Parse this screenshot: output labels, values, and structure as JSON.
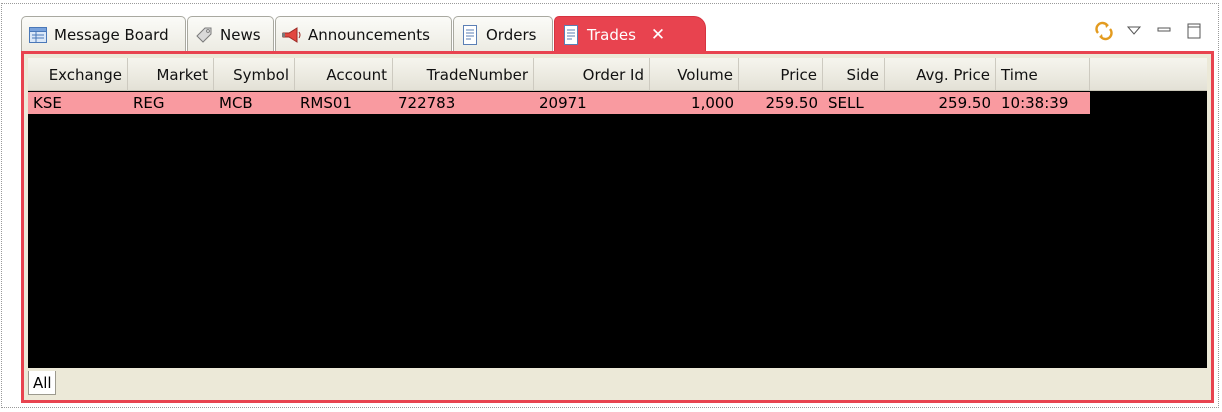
{
  "tabs": [
    {
      "label": "Message Board",
      "icon": "message-board-icon"
    },
    {
      "label": "News",
      "icon": "news-tag-icon"
    },
    {
      "label": "Announcements",
      "icon": "megaphone-icon"
    },
    {
      "label": "Orders",
      "icon": "document-icon"
    },
    {
      "label": "Trades",
      "icon": "document-icon",
      "active": true,
      "close": "✕"
    }
  ],
  "view_tools": {
    "sync": "sync-icon",
    "menu": "view-menu-icon",
    "minimize": "minimize-icon",
    "maximize": "maximize-icon"
  },
  "grid": {
    "headers": [
      "Exchange",
      "Market",
      "Symbol",
      "Account",
      "TradeNumber",
      "Order Id",
      "Volume",
      "Price",
      "Side",
      "Avg. Price",
      "Time"
    ],
    "rows": [
      [
        "KSE",
        "REG",
        "MCB",
        "RMS01",
        "722783",
        "20971",
        "1,000",
        "259.50",
        "SELL",
        "259.50",
        "10:38:39"
      ]
    ]
  },
  "bottom_tabs": [
    {
      "label": "All"
    }
  ],
  "colors": {
    "accent": "#e8434f",
    "row_highlight": "#f99aa0",
    "grid_background": "#000000"
  }
}
